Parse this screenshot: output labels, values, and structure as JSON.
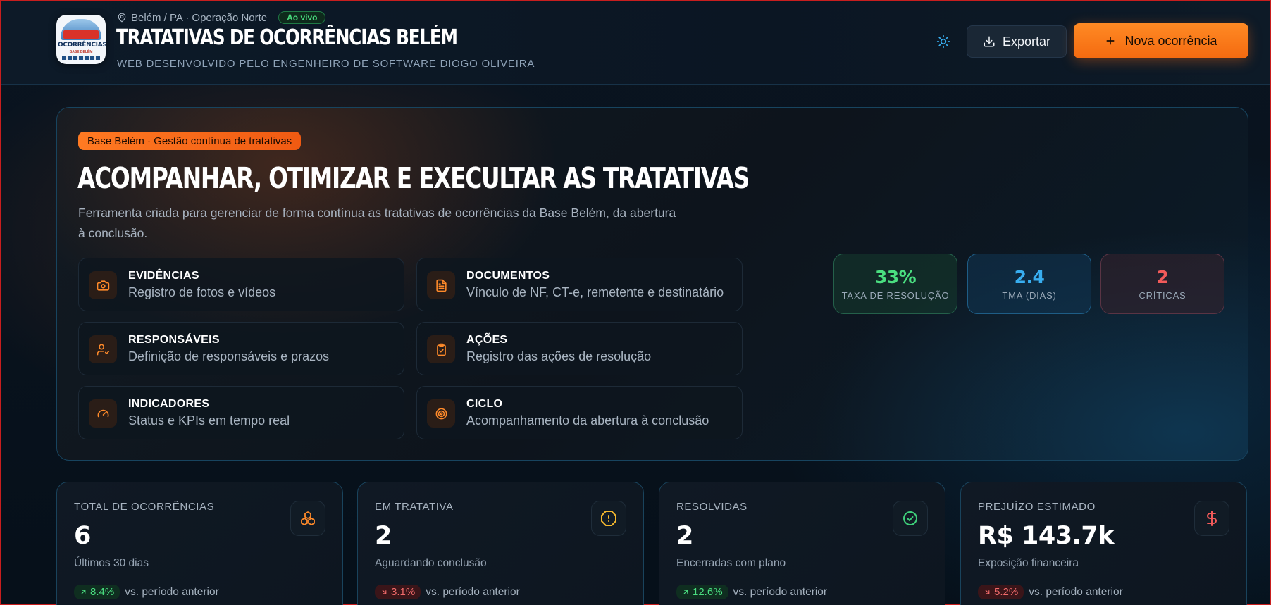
{
  "header": {
    "logo_text": "OCORRÊNCIAS",
    "logo_sub": "BASE BELÉM",
    "location": "Belém / PA · Operação Norte",
    "live_badge": "Ao vivo",
    "title": "TRATATIVAS DE OCORRÊNCIAS BELÉM",
    "subtitle": "WEB DESENVOLVIDO PELO ENGENHEIRO DE SOFTWARE DIOGO OLIVEIRA",
    "export_label": "Exportar",
    "new_label": "Nova ocorrência"
  },
  "hero": {
    "badge": "Base Belém · Gestão contínua de tratativas",
    "title": "ACOMPANHAR, OTIMIZAR E EXECULTAR AS TRATATIVAS",
    "description": "Ferramenta criada para gerenciar de forma contínua as tratativas de ocorrências da Base Belém, da abertura à conclusão.",
    "features": [
      {
        "title": "EVIDÊNCIAS",
        "desc": "Registro de fotos e vídeos",
        "icon": "camera-icon"
      },
      {
        "title": "DOCUMENTOS",
        "desc": "Vínculo de NF, CT-e, remetente e destinatário",
        "icon": "file-text-icon"
      },
      {
        "title": "RESPONSÁVEIS",
        "desc": "Definição de responsáveis e prazos",
        "icon": "user-check-icon"
      },
      {
        "title": "AÇÕES",
        "desc": "Registro das ações de resolução",
        "icon": "clipboard-check-icon"
      },
      {
        "title": "INDICADORES",
        "desc": "Status e KPIs em tempo real",
        "icon": "gauge-icon"
      },
      {
        "title": "CICLO",
        "desc": "Acompanhamento da abertura à conclusão",
        "icon": "target-icon"
      }
    ],
    "kpis": [
      {
        "value": "33%",
        "label": "TAXA DE RESOLUÇÃO",
        "color": "#4ade80"
      },
      {
        "value": "2.4",
        "label": "TMA (DIAS)",
        "color": "#38aef0"
      },
      {
        "value": "2",
        "label": "CRÍTICAS",
        "color": "#f25a5a"
      }
    ]
  },
  "stats": [
    {
      "label": "TOTAL DE OCORRÊNCIAS",
      "value": "6",
      "sub": "Últimos 30 dias",
      "trend": "8.4%",
      "direction": "up",
      "trend_text": "vs. período anterior",
      "icon": "boxes-icon",
      "color": "#ff8a2a"
    },
    {
      "label": "EM TRATATIVA",
      "value": "2",
      "sub": "Aguardando conclusão",
      "trend": "3.1%",
      "direction": "down",
      "trend_text": "vs. período anterior",
      "icon": "alert-octagon-icon",
      "color": "#f5b82e"
    },
    {
      "label": "RESOLVIDAS",
      "value": "2",
      "sub": "Encerradas com plano",
      "trend": "12.6%",
      "direction": "up",
      "trend_text": "vs. período anterior",
      "icon": "check-circle-icon",
      "color": "#3ecf7a"
    },
    {
      "label": "PREJUÍZO ESTIMADO",
      "value": "R$ 143.7k",
      "sub": "Exposição financeira",
      "trend": "5.2%",
      "direction": "down",
      "trend_text": "vs. período anterior",
      "icon": "dollar-sign-icon",
      "color": "#f25a5a"
    }
  ]
}
